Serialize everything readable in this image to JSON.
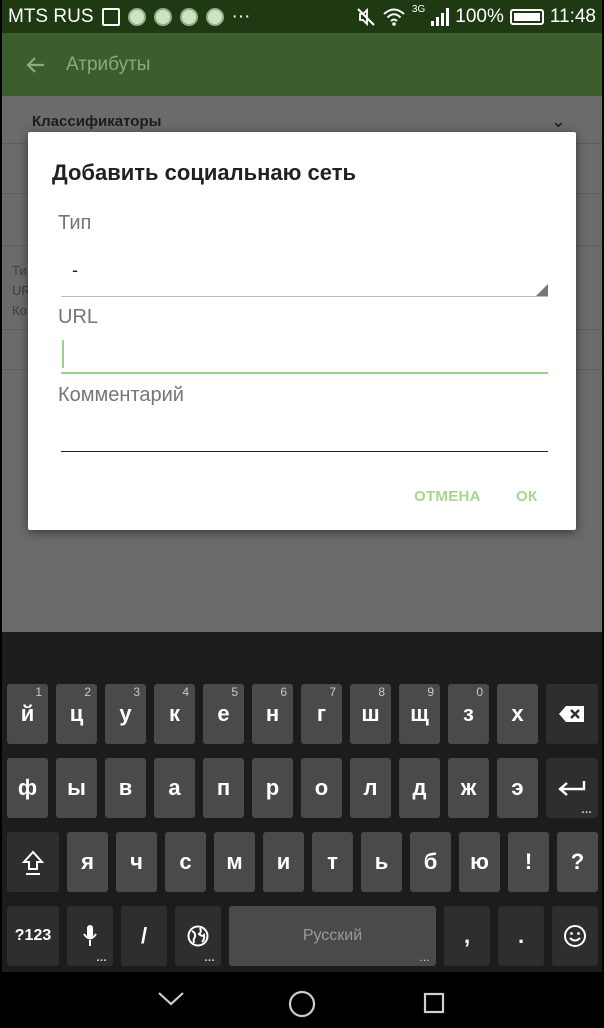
{
  "status_bar": {
    "carrier": "MTS RUS",
    "more": "···",
    "network_type": "3G",
    "battery": "100%",
    "time": "11:48"
  },
  "app": {
    "back_icon": "arrow-left-icon",
    "title": "Атрибуты",
    "section_title": "Классификаторы",
    "background_rows": [
      "Ти",
      "UR",
      "Ко"
    ]
  },
  "dialog": {
    "title": "Добавить социальнаю сеть",
    "type_label": "Тип",
    "type_value": "-",
    "url_label": "URL",
    "url_value": "",
    "comment_label": "Комментарий",
    "comment_value": "",
    "cancel_label": "ОТМЕНА",
    "ok_label": "ОК",
    "accent_color": "#a6d68f"
  },
  "keyboard": {
    "row1": [
      {
        "char": "й",
        "hint": "1"
      },
      {
        "char": "ц",
        "hint": "2"
      },
      {
        "char": "у",
        "hint": "3"
      },
      {
        "char": "к",
        "hint": "4"
      },
      {
        "char": "е",
        "hint": "5"
      },
      {
        "char": "н",
        "hint": "6"
      },
      {
        "char": "г",
        "hint": "7"
      },
      {
        "char": "ш",
        "hint": "8"
      },
      {
        "char": "щ",
        "hint": "9"
      },
      {
        "char": "з",
        "hint": "0"
      },
      {
        "char": "х",
        "hint": ""
      }
    ],
    "row2": [
      "ф",
      "ы",
      "в",
      "а",
      "п",
      "р",
      "о",
      "л",
      "д",
      "ж",
      "э"
    ],
    "row3": [
      "я",
      "ч",
      "с",
      "м",
      "и",
      "т",
      "ь",
      "б",
      "ю",
      "!",
      "?"
    ],
    "symbols_label": "?123",
    "slash": "/",
    "space_label": "Русский",
    "comma": ",",
    "period": "."
  }
}
